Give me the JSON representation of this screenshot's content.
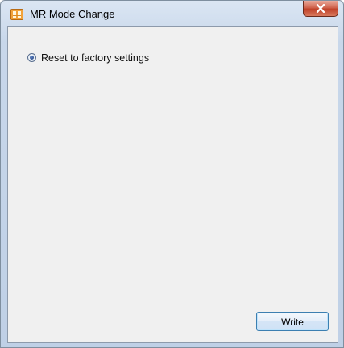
{
  "window": {
    "title": "MR Mode Change",
    "accent_colors": {
      "frame": "#bfd0e6",
      "close_button": "#c04128",
      "client": "#f0f0f0"
    },
    "icons": {
      "app": "app-icon",
      "close": "close-icon"
    }
  },
  "options": {
    "reset_label": "Reset to factory settings",
    "reset_selected": true
  },
  "actions": {
    "write_label": "Write"
  }
}
